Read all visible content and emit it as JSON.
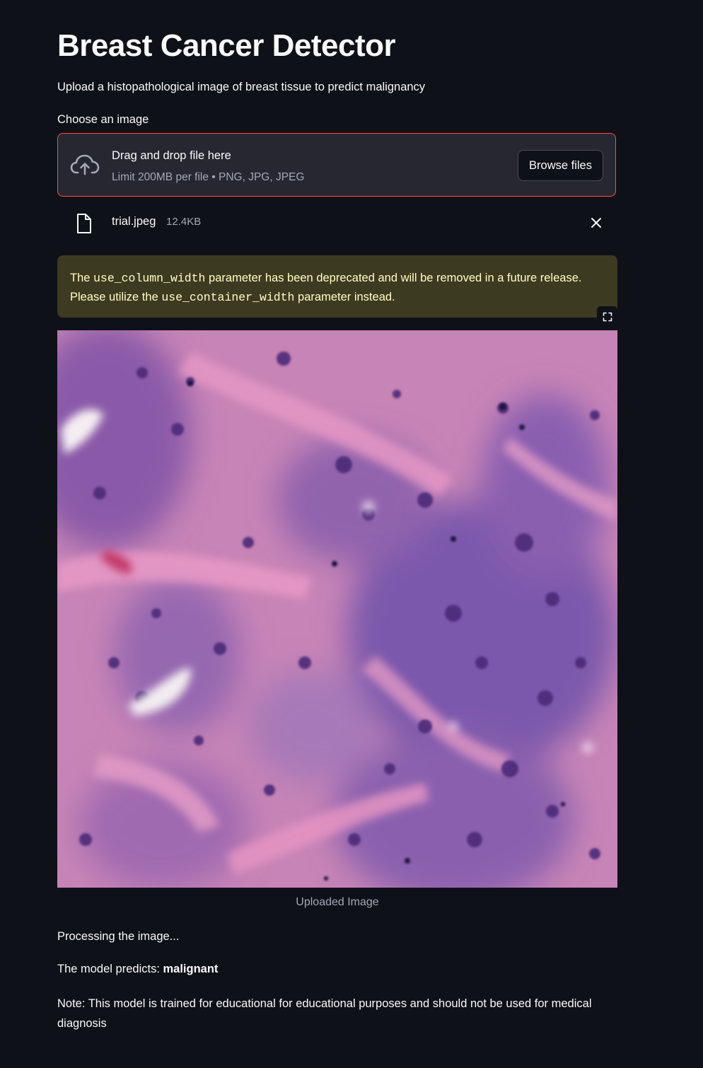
{
  "page": {
    "title": "Breast Cancer Detector",
    "subtitle": "Upload a histopathological image of breast tissue to predict malignancy"
  },
  "uploader": {
    "label": "Choose an image",
    "drag_text": "Drag and drop file here",
    "limit_text": "Limit 200MB per file • PNG, JPG, JPEG",
    "browse_label": "Browse files",
    "border_color": "#ff4b4b"
  },
  "uploaded_file": {
    "name": "trial.jpeg",
    "size": "12.4KB"
  },
  "warning": {
    "prefix": "The ",
    "param_old": "use_column_width",
    "middle": " parameter has been deprecated and will be removed in a future release. Please utilize the ",
    "param_new": "use_container_width",
    "suffix": " parameter instead.",
    "background": "#3d3a22",
    "text_color": "#ffffc2"
  },
  "image": {
    "caption": "Uploaded Image",
    "fullscreen_icon": "expand-icon"
  },
  "results": {
    "processing": "Processing the image...",
    "prediction_prefix": "The model predicts: ",
    "prediction_value": "malignant",
    "note": "Note: This model is trained for educational for educational purposes and should not be used for medical diagnosis"
  },
  "theme": {
    "background": "#0e1117",
    "surface": "#262730",
    "text": "#fafafa",
    "muted": "#a3a8b8",
    "accent": "#ff4b4b"
  }
}
